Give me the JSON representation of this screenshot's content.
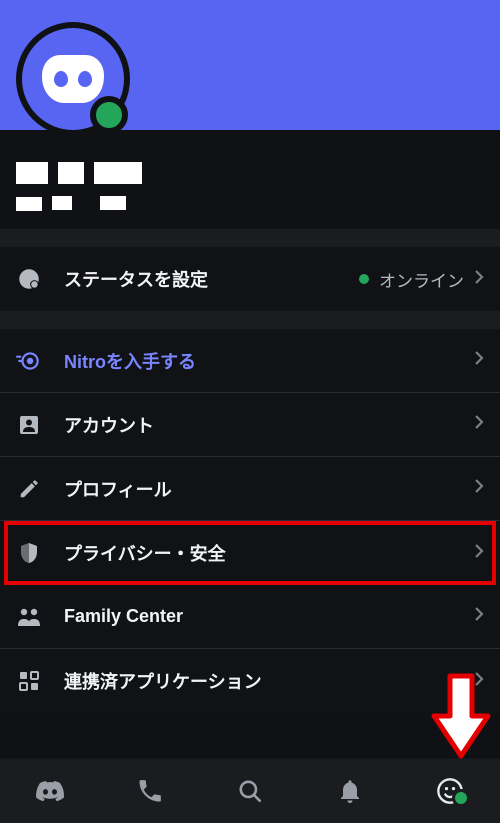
{
  "status": {
    "set_label": "ステータスを設定",
    "value": "オンライン"
  },
  "settings": {
    "nitro": "Nitroを入手する",
    "account": "アカウント",
    "profile": "プロフィール",
    "privacy_safety": "プライバシー・安全",
    "family_center": "Family Center",
    "authorized_apps": "連携済アプリケーション"
  }
}
